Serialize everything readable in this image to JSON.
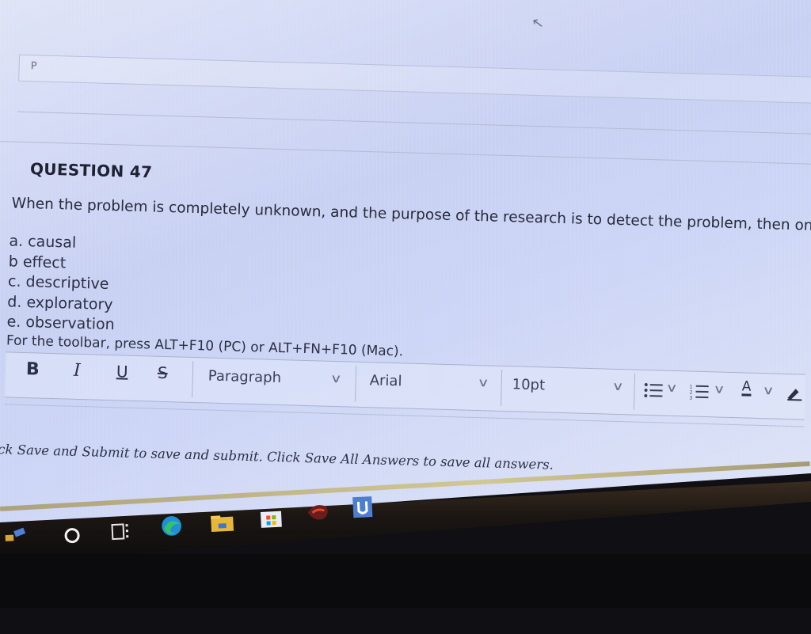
{
  "page": {
    "placeholder_letter": "P",
    "question": {
      "title": "QUESTION 47",
      "text": "When the problem is completely unknown, and the purpose of the research is to detect the problem, then one should use re",
      "options": [
        "a. causal",
        "b effect",
        "c. descriptive",
        "d. exploratory",
        "e. observation"
      ],
      "toolbar_hint": "For the toolbar, press ALT+F10 (PC) or ALT+FN+F10 (Mac)."
    },
    "toolbar": {
      "bold": "B",
      "italic": "I",
      "underline": "U",
      "strike": "S",
      "paragraph": "Paragraph",
      "font": "Arial",
      "size": "10pt",
      "text_color": "A"
    },
    "footer_text": "Click Save and Submit to save and submit. Click Save All Answers to save all answers."
  },
  "icons": [
    "cursor-arrow-icon",
    "bold-icon",
    "italic-icon",
    "underline-icon",
    "strikethrough-icon",
    "chevron-down-icon",
    "bulleted-list-icon",
    "numbered-list-icon",
    "text-color-icon",
    "highlight-icon",
    "cortana-icon",
    "task-view-icon",
    "edge-icon",
    "file-explorer-icon",
    "store-icon",
    "game-app-icon",
    "app-icon"
  ],
  "colors": {
    "screen": "#cdd6f6",
    "text": "#262a3b",
    "taskbar": "#1b1612"
  }
}
